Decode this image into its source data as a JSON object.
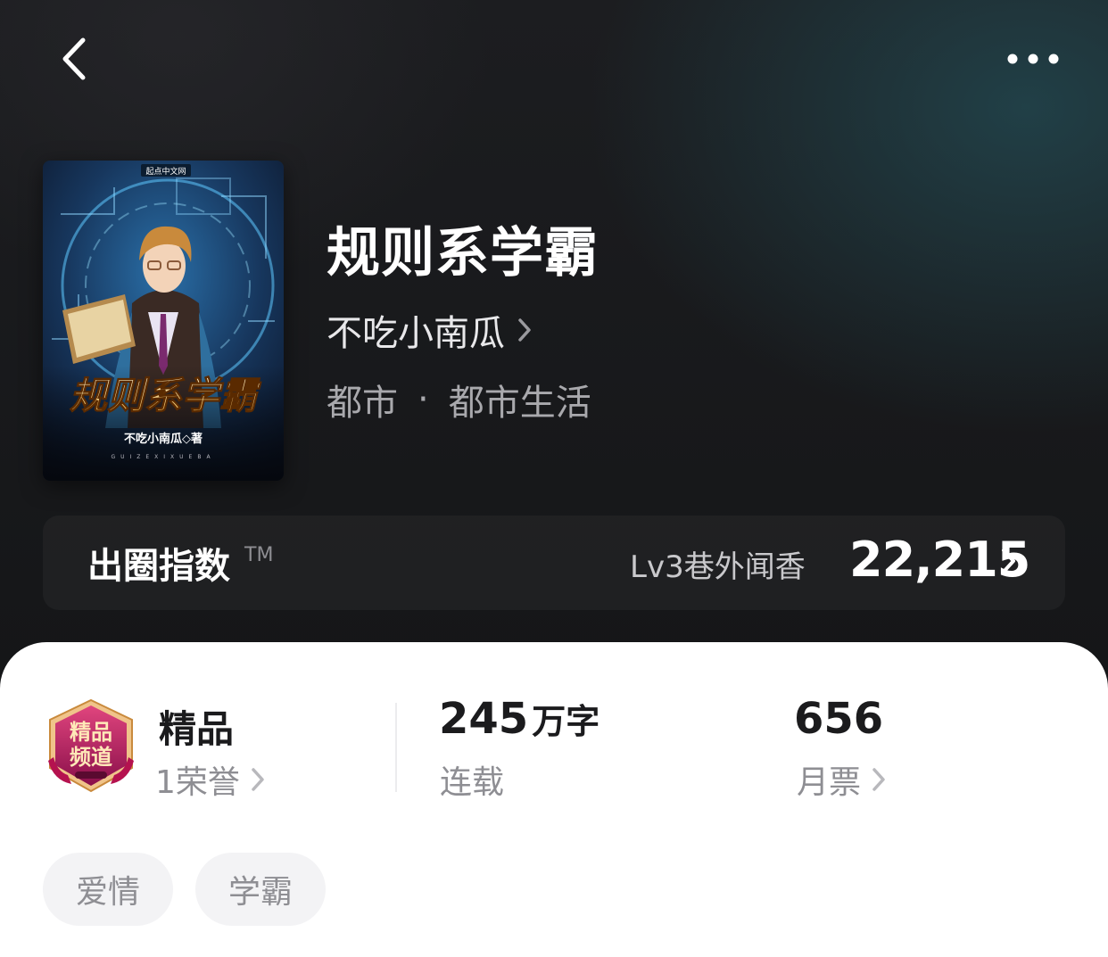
{
  "header": {
    "back_icon": "chevron-left-icon",
    "more_icon": "more-dots-icon"
  },
  "book": {
    "title": "规则系学霸",
    "author": "不吃小南瓜",
    "category": "都市",
    "separator": "·",
    "subcategory": "都市生活",
    "cover": {
      "publisher_mark": "起点中文网",
      "cover_title": "规则系学霸",
      "cover_author": "不吃小南瓜◇著",
      "cover_pinyin": "GUIZEXIXUEBA"
    }
  },
  "influence_index": {
    "label": "出圈指数",
    "tm": "TM",
    "level": "Lv3巷外闻香",
    "value": "22,215"
  },
  "stats": {
    "quality": {
      "badge_text": "精品频道",
      "title": "精品",
      "honors": "1荣誉"
    },
    "words": {
      "number": "245",
      "unit": "万字",
      "status": "连载"
    },
    "tickets": {
      "number": "656",
      "label": "月票"
    }
  },
  "tags": [
    "爱情",
    "学霸"
  ],
  "colors": {
    "hero_bg": "#161719",
    "hero_teal_glow": "#22464e",
    "sheet_bg": "#ffffff",
    "tag_bg": "#f3f3f5",
    "text_primary": "#1b1b1d",
    "text_secondary": "#8e8e93",
    "badge_magenta": "#a3135a"
  }
}
